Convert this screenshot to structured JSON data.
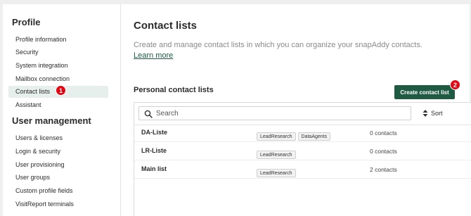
{
  "sidebar": {
    "profile_heading": "Profile",
    "profile_items": [
      {
        "label": "Profile information"
      },
      {
        "label": "Security"
      },
      {
        "label": "System integration"
      },
      {
        "label": "Mailbox connection"
      },
      {
        "label": "Contact lists",
        "active": true
      },
      {
        "label": "Assistant"
      }
    ],
    "user_management_heading": "User management",
    "user_management_items": [
      {
        "label": "Users & licenses"
      },
      {
        "label": "Login & security"
      },
      {
        "label": "User provisioning"
      },
      {
        "label": "User groups"
      },
      {
        "label": "Custom profile fields"
      },
      {
        "label": "VisitReport terminals"
      }
    ]
  },
  "markers": {
    "first": "1",
    "second": "2"
  },
  "main": {
    "title": "Contact lists",
    "description": "Create and manage contact lists in which you can organize your snapAddy contacts.",
    "learn_more": "Learn more",
    "section_title": "Personal contact lists",
    "create_button": "Create contact list",
    "search": {
      "placeholder": "Search",
      "value": ""
    },
    "sort_label": "Sort",
    "lists": [
      {
        "name": "DA-Liste",
        "tags": [
          "LeadResearch",
          "DataAgents"
        ],
        "count": "0 contacts"
      },
      {
        "name": "LR-Liste",
        "tags": [
          "LeadResearch"
        ],
        "count": "0 contacts"
      },
      {
        "name": "Main list",
        "tags": [
          "LeadResearch"
        ],
        "count": "2 contacts"
      }
    ]
  },
  "colors": {
    "accent": "#1f5b43",
    "active_item_bg": "#e6efeb",
    "marker": "#e20613"
  },
  "icons": {
    "search": "search-icon",
    "sort": "sort-arrows-icon"
  }
}
